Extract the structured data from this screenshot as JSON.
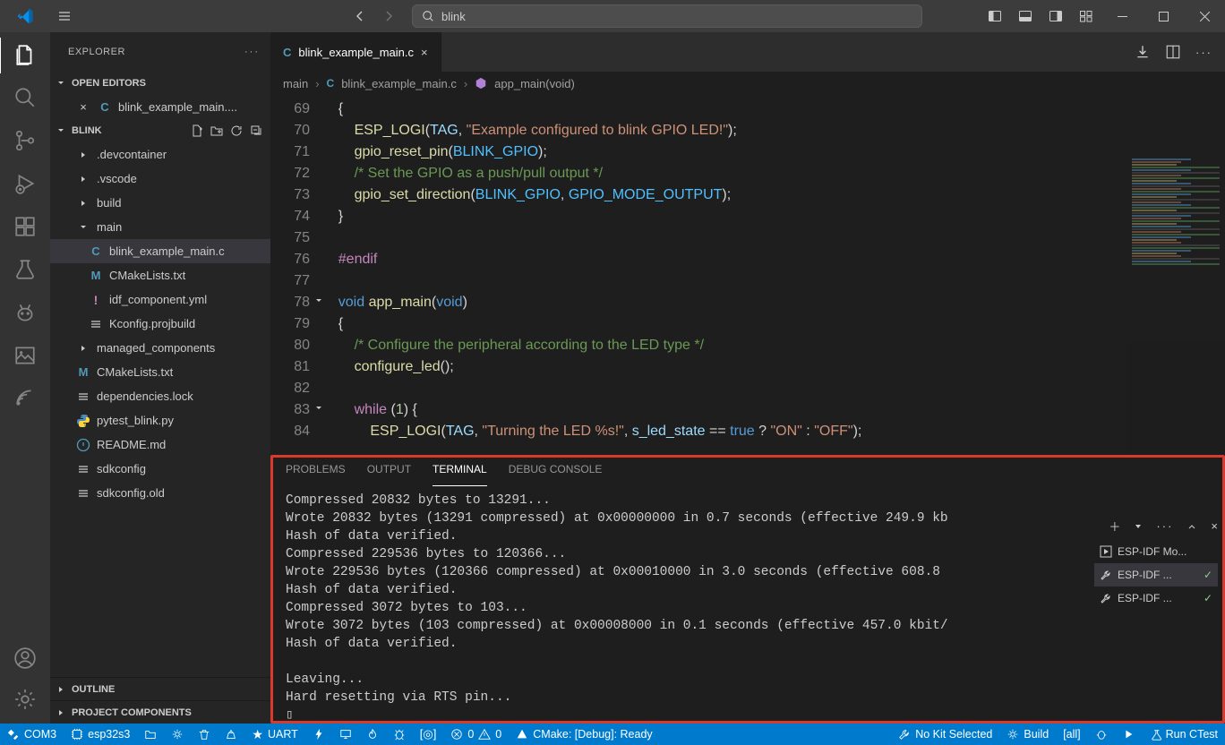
{
  "titlebar": {
    "search": "blink"
  },
  "explorer": {
    "title": "EXPLORER",
    "openEditors": "OPEN EDITORS",
    "project": "BLINK",
    "editor": {
      "name": "blink_example_main....",
      "close": "×"
    },
    "tree": [
      {
        "name": ".devcontainer",
        "type": "folder",
        "depth": 1
      },
      {
        "name": ".vscode",
        "type": "folder",
        "depth": 1
      },
      {
        "name": "build",
        "type": "folder",
        "depth": 1
      },
      {
        "name": "main",
        "type": "folder",
        "depth": 1,
        "open": true
      },
      {
        "name": "blink_example_main.c",
        "type": "c",
        "depth": 2,
        "sel": true
      },
      {
        "name": "CMakeLists.txt",
        "type": "m",
        "depth": 2
      },
      {
        "name": "idf_component.yml",
        "type": "yml",
        "depth": 2
      },
      {
        "name": "Kconfig.projbuild",
        "type": "txt",
        "depth": 2
      },
      {
        "name": "managed_components",
        "type": "folder",
        "depth": 1
      },
      {
        "name": "CMakeLists.txt",
        "type": "m",
        "depth": 1
      },
      {
        "name": "dependencies.lock",
        "type": "txt",
        "depth": 1
      },
      {
        "name": "pytest_blink.py",
        "type": "py",
        "depth": 1
      },
      {
        "name": "README.md",
        "type": "md",
        "depth": 1
      },
      {
        "name": "sdkconfig",
        "type": "txt",
        "depth": 1
      },
      {
        "name": "sdkconfig.old",
        "type": "txt",
        "depth": 1
      }
    ],
    "outline": "OUTLINE",
    "components": "PROJECT COMPONENTS"
  },
  "tab": {
    "file": "blink_example_main.c"
  },
  "breadcrumb": {
    "p0": "main",
    "p1": "blink_example_main.c",
    "p2": "app_main(void)"
  },
  "code": {
    "lines": [
      {
        "n": 69,
        "html": "    <span class='c-pn'>{</span>"
      },
      {
        "n": 70,
        "html": "        <span class='c-fn'>ESP_LOGI</span><span class='c-pn'>(</span><span class='c-var'>TAG</span><span class='c-pn'>, </span><span class='c-str'>\"Example configured to blink GPIO LED!\"</span><span class='c-pn'>);</span>"
      },
      {
        "n": 71,
        "html": "        <span class='c-fn'>gpio_reset_pin</span><span class='c-pn'>(</span><span class='c-const'>BLINK_GPIO</span><span class='c-pn'>);</span>"
      },
      {
        "n": 72,
        "html": "        <span class='c-com'>/* Set the GPIO as a push/pull output */</span>"
      },
      {
        "n": 73,
        "html": "        <span class='c-fn'>gpio_set_direction</span><span class='c-pn'>(</span><span class='c-const'>BLINK_GPIO</span><span class='c-pn'>, </span><span class='c-const'>GPIO_MODE_OUTPUT</span><span class='c-pn'>);</span>"
      },
      {
        "n": 74,
        "html": "    <span class='c-pn'>}</span>"
      },
      {
        "n": 75,
        "html": ""
      },
      {
        "n": 76,
        "html": "    <span class='c-pp'>#endif</span>"
      },
      {
        "n": 77,
        "html": ""
      },
      {
        "n": 78,
        "html": "    <span class='c-kw'>void</span> <span class='c-fn'>app_main</span><span class='c-pn'>(</span><span class='c-kw'>void</span><span class='c-pn'>)</span>",
        "fold": "open"
      },
      {
        "n": 79,
        "html": "    <span class='c-pn'>{</span>"
      },
      {
        "n": 80,
        "html": "        <span class='c-com'>/* Configure the peripheral according to the LED type */</span>"
      },
      {
        "n": 81,
        "html": "        <span class='c-fn'>configure_led</span><span class='c-pn'>();</span>"
      },
      {
        "n": 82,
        "html": ""
      },
      {
        "n": 83,
        "html": "        <span class='c-pp'>while</span> <span class='c-pn'>(</span><span class='c-num'>1</span><span class='c-pn'>) {</span>",
        "fold": "open"
      },
      {
        "n": 84,
        "html": "            <span class='c-fn'>ESP_LOGI</span><span class='c-pn'>(</span><span class='c-var'>TAG</span><span class='c-pn'>, </span><span class='c-str'>\"Turning the LED %s!\"</span><span class='c-pn'>, </span><span class='c-var'>s_led_state</span><span class='c-pn'> == </span><span class='c-kw'>true</span><span class='c-pn'> ? </span><span class='c-str'>\"ON\"</span><span class='c-pn'> : </span><span class='c-str'>\"OFF\"</span><span class='c-pn'>);</span>"
      }
    ]
  },
  "panel": {
    "tabs": {
      "problems": "PROBLEMS",
      "output": "OUTPUT",
      "terminal": "TERMINAL",
      "debug": "DEBUG CONSOLE"
    },
    "terminal": "Compressed 20832 bytes to 13291...\nWrote 20832 bytes (13291 compressed) at 0x00000000 in 0.7 seconds (effective 249.9 kb\nHash of data verified.\nCompressed 229536 bytes to 120366...\nWrote 229536 bytes (120366 compressed) at 0x00010000 in 3.0 seconds (effective 608.8\nHash of data verified.\nCompressed 3072 bytes to 103...\nWrote 3072 bytes (103 compressed) at 0x00008000 in 0.1 seconds (effective 457.0 kbit/\nHash of data verified.\n\nLeaving...\nHard resetting via RTS pin...\n▯",
    "tasks": [
      {
        "name": "ESP-IDF Mo...",
        "icon": "play"
      },
      {
        "name": "ESP-IDF ...",
        "icon": "tool",
        "sel": true,
        "check": true
      },
      {
        "name": "ESP-IDF ...",
        "icon": "tool",
        "check": true
      }
    ]
  },
  "status": {
    "com": "COM3",
    "target": "esp32s3",
    "uart": "UART",
    "problems": {
      "err": "0",
      "warn": "0"
    },
    "cmake": "CMake: [Debug]: Ready",
    "kit": "No Kit Selected",
    "build": "Build",
    "all": "[all]",
    "ctest": "Run CTest"
  }
}
